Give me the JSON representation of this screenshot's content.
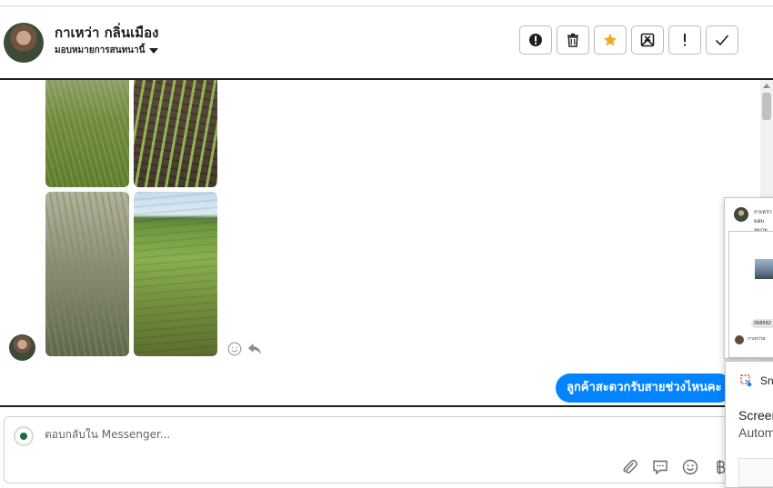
{
  "header": {
    "contact_name": "กาเหว่า กลิ่นเมือง",
    "assign_label": "มอบหมายการสนทนานี้",
    "actions": [
      {
        "name": "spam-button",
        "icon": "alert-circle-icon"
      },
      {
        "name": "delete-button",
        "icon": "trash-icon"
      },
      {
        "name": "star-button",
        "icon": "star-icon",
        "color": "#f5a623"
      },
      {
        "name": "mark-unread-button",
        "icon": "envelope-x-icon"
      },
      {
        "name": "priority-button",
        "icon": "exclamation-icon"
      },
      {
        "name": "mark-done-button",
        "icon": "check-icon"
      }
    ]
  },
  "conversation": {
    "incoming_images": [
      "rice-field-photo-1",
      "corn-seedlings-photo",
      "flooded-rice-photo",
      "green-field-photo"
    ],
    "outgoing_message": "ลูกค้าสะดวกรับสายช่วงไหนคะ",
    "accent_color": "#0084ff"
  },
  "composer": {
    "placeholder": "ตอบกลับใน Messenger..."
  },
  "preview_card": {
    "name_text": "กาเหว่า",
    "sub_text": "มอบหมาย",
    "phone_text": "098562",
    "reply_text": "กาเหว่าผ"
  },
  "notification": {
    "app_name": "Sn",
    "title": "Screen",
    "body": "Autom"
  }
}
